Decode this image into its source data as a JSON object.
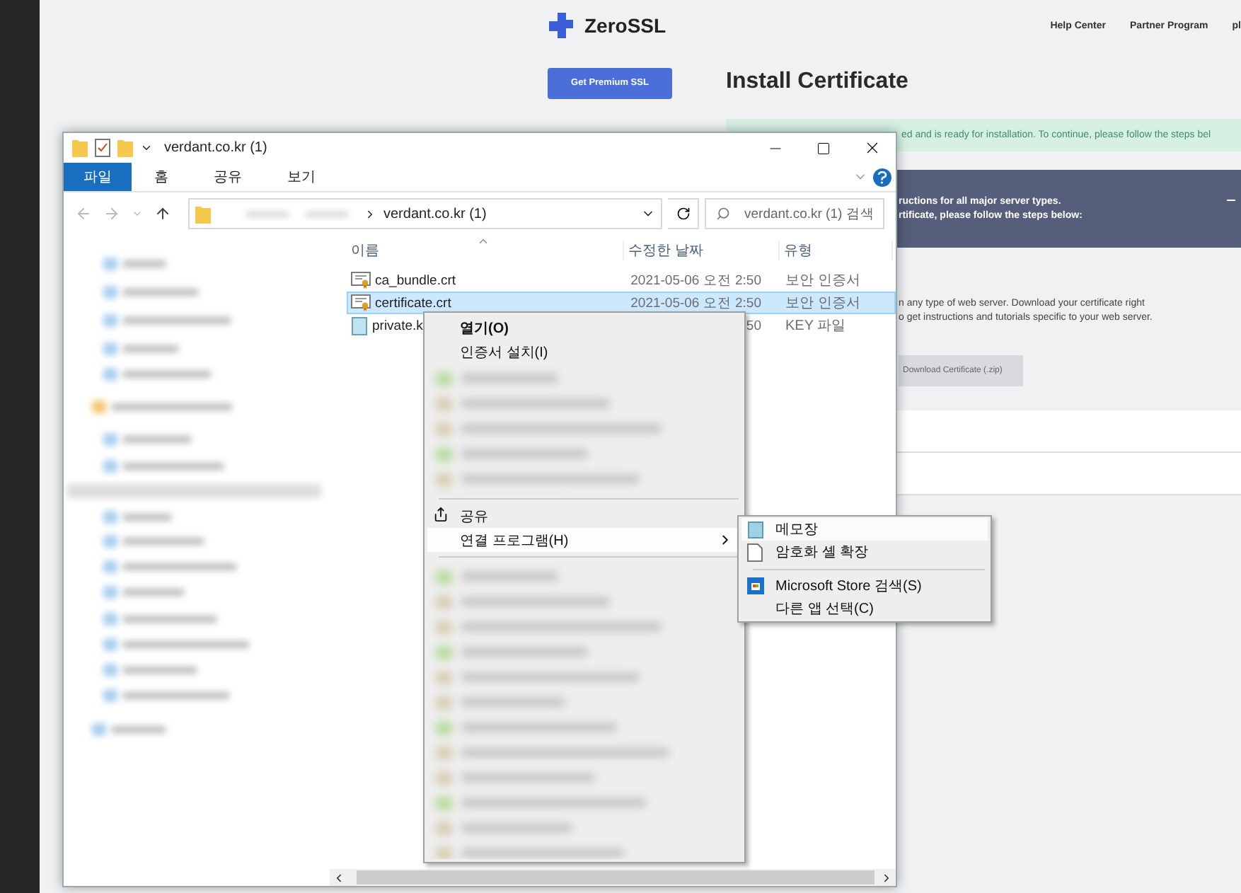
{
  "web_page": {
    "logo": "ZeroSSL",
    "nav_links": [
      "Help Center",
      "Partner Program",
      "pl"
    ],
    "premium_button": "Get Premium SSL",
    "heading": "Install Certificate",
    "alert": "ed and is ready for installation. To continue, please follow the steps bel",
    "banner_lines": [
      "ructions for all major server types.",
      "rtificate, please follow the steps below:"
    ],
    "body_lines": [
      "n any type of web server. Download your certificate right",
      "o get instructions and tutorials specific to your web server."
    ],
    "download_button": "Download Certificate (.zip)"
  },
  "explorer": {
    "title": "verdant.co.kr (1)",
    "ribbon_tabs": [
      {
        "label": "파일",
        "selected": true
      },
      {
        "label": "홈",
        "selected": false
      },
      {
        "label": "공유",
        "selected": false
      },
      {
        "label": "보기",
        "selected": false
      }
    ],
    "address": "verdant.co.kr (1)",
    "search": {
      "placeholder": "verdant.co.kr (1) 검색"
    },
    "columns": [
      "이름",
      "수정한 날짜",
      "유형"
    ],
    "files": [
      {
        "kind": "certificate",
        "name": "ca_bundle.crt",
        "modified": "2021-05-06 오전 2:50",
        "type": "보안 인증서",
        "selected": false
      },
      {
        "kind": "certificate",
        "name": "certificate.crt",
        "modified": "2021-05-06 오전 2:50",
        "type": "보안 인증서",
        "selected": true
      },
      {
        "kind": "key",
        "name": "private.k",
        "modified": "50",
        "type": "KEY 파일",
        "selected": false
      }
    ]
  },
  "context_menu": {
    "items": [
      {
        "kind": "item",
        "label": "열기(O)",
        "bold": true,
        "highlighted": false
      },
      {
        "kind": "item",
        "label": "인증서 설치(I)",
        "bold": false,
        "highlighted": false
      },
      {
        "kind": "blurred"
      },
      {
        "kind": "separator"
      },
      {
        "kind": "share",
        "label": "공유",
        "bold": false,
        "highlighted": false
      },
      {
        "kind": "submenu",
        "label": "연결 프로그램(H)",
        "bold": false,
        "highlighted": true
      },
      {
        "kind": "separator"
      },
      {
        "kind": "blurred"
      }
    ],
    "submenu": [
      {
        "kind": "notepad",
        "label": "메모장",
        "highlighted": true
      },
      {
        "kind": "file",
        "label": "암호화 셸 확장",
        "highlighted": false
      },
      {
        "kind": "separator"
      },
      {
        "kind": "store",
        "label": "Microsoft Store 검색(S)",
        "highlighted": false
      },
      {
        "kind": "plain",
        "label": "다른 앱 선택(C)",
        "highlighted": false
      }
    ]
  }
}
